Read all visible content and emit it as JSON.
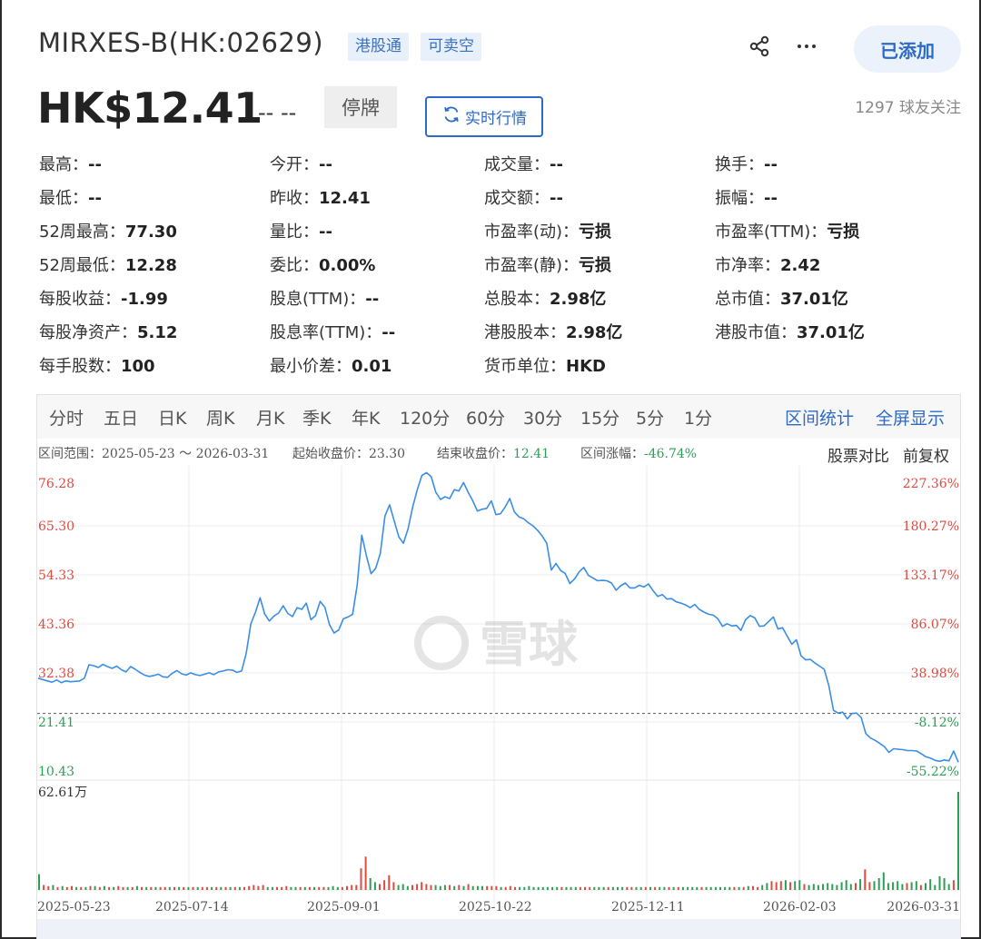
{
  "header": {
    "title": "MIRXES-B(HK:02629)",
    "tags": [
      "港股通",
      "可卖空"
    ],
    "share_icon": "share-icon",
    "more_icon": "more-dots-icon",
    "added_label": "已添加",
    "accent_color": "#2d6bc6"
  },
  "quote": {
    "price": "HK$12.41",
    "change": "-- --",
    "status": "停牌",
    "realtime_label": "实时行情",
    "realtime_icon": "refresh-icon",
    "followers": "1297 球友关注"
  },
  "stats": [
    [
      {
        "label": "最高：",
        "value": "--"
      },
      {
        "label": "今开：",
        "value": "--"
      },
      {
        "label": "成交量：",
        "value": "--"
      },
      {
        "label": "换手：",
        "value": "--"
      }
    ],
    [
      {
        "label": "最低：",
        "value": "--"
      },
      {
        "label": "昨收：",
        "value": "12.41"
      },
      {
        "label": "成交额：",
        "value": "--"
      },
      {
        "label": "振幅：",
        "value": "--"
      }
    ],
    [
      {
        "label": "52周最高：",
        "value": "77.30"
      },
      {
        "label": "量比：",
        "value": "--"
      },
      {
        "label": "市盈率(动)：",
        "value": "亏损"
      },
      {
        "label": "市盈率(TTM)：",
        "value": "亏损"
      }
    ],
    [
      {
        "label": "52周最低：",
        "value": "12.28"
      },
      {
        "label": "委比：",
        "value": "0.00%"
      },
      {
        "label": "市盈率(静)：",
        "value": "亏损"
      },
      {
        "label": "市净率：",
        "value": "2.42"
      }
    ],
    [
      {
        "label": "每股收益：",
        "value": "-1.99"
      },
      {
        "label": "股息(TTM)：",
        "value": "--"
      },
      {
        "label": "总股本：",
        "value": "2.98亿"
      },
      {
        "label": "总市值：",
        "value": "37.01亿"
      }
    ],
    [
      {
        "label": "每股净资产：",
        "value": "5.12"
      },
      {
        "label": "股息率(TTM)：",
        "value": "--"
      },
      {
        "label": "港股股本：",
        "value": "2.98亿"
      },
      {
        "label": "港股市值：",
        "value": "37.01亿"
      }
    ],
    [
      {
        "label": "每手股数：",
        "value": "100"
      },
      {
        "label": "最小价差：",
        "value": "0.01"
      },
      {
        "label": "货币单位：",
        "value": "HKD"
      }
    ]
  ],
  "tabs": [
    "分时",
    "五日",
    "日K",
    "周K",
    "月K",
    "季K",
    "年K",
    "120分",
    "60分",
    "30分",
    "15分",
    "5分",
    "1分"
  ],
  "tab_links": [
    "区间统计",
    "全屏显示"
  ],
  "range_info": {
    "range_label": "区间范围：",
    "range_value": "2025-05-23 ～ 2026-03-31",
    "start_label": "起始收盘价：",
    "start_value": "23.30",
    "end_label": "结束收盘价：",
    "end_value": "12.41",
    "change_label": "区间涨幅：",
    "change_value": "-46.74%",
    "compare": "股票对比",
    "adjust": "前复权"
  },
  "watermark": "雪球",
  "chart_data": {
    "type": "line",
    "y_ticks": [
      "76.28",
      "65.30",
      "54.33",
      "43.36",
      "32.38",
      "21.41",
      "10.43"
    ],
    "y_pct_ticks": [
      "227.36%",
      "180.27%",
      "133.17%",
      "86.07%",
      "38.98%",
      "-8.12%",
      "-55.22%"
    ],
    "ylim": [
      10.43,
      76.28
    ],
    "reference_close": 23.3,
    "x_ticks": [
      "2025-05-23",
      "2025-07-14",
      "2025-09-01",
      "2025-10-22",
      "2025-12-11",
      "2026-02-03",
      "2026-03-31"
    ],
    "volume_max_label": "62.61万",
    "series": [
      {
        "values": [
          31.2,
          30.9,
          30.6,
          30.3,
          30.8,
          30.2,
          30.6,
          30.4,
          30.5,
          30.6,
          31.2,
          34.2,
          34.0,
          33.6,
          34.3,
          33.8,
          33.4,
          33.9,
          33.1,
          32.6,
          33.8,
          33.2,
          32.5,
          31.9,
          31.6,
          31.8,
          32.1,
          31.5,
          31.4,
          32.3,
          32.9,
          32.2,
          31.9,
          32.4,
          32.0,
          31.8,
          32.1,
          32.4,
          32.0,
          32.6,
          32.8,
          33.1,
          33.0,
          32.5,
          32.8,
          36.8,
          43.4,
          46.0,
          49.2,
          45.6,
          44.0,
          45.1,
          45.8,
          47.4,
          45.7,
          45.0,
          47.0,
          46.6,
          48.0,
          44.3,
          45.2,
          48.4,
          47.1,
          43.2,
          41.3,
          42.0,
          44.5,
          44.9,
          45.5,
          52.0,
          63.2,
          58.6,
          54.6,
          55.8,
          59.1,
          67.5,
          70.0,
          66.4,
          62.8,
          61.4,
          64.6,
          69.5,
          73.4,
          76.6,
          77.2,
          76.3,
          72.8,
          71.2,
          71.8,
          71.4,
          73.4,
          73.1,
          75.0,
          72.8,
          70.9,
          68.6,
          69.0,
          69.2,
          70.9,
          67.8,
          68.0,
          69.5,
          71.4,
          68.4,
          67.3,
          66.9,
          66.0,
          65.3,
          64.3,
          63.0,
          61.4,
          55.4,
          56.9,
          55.3,
          54.6,
          52.4,
          53.4,
          55.0,
          56.0,
          54.2,
          53.6,
          53.0,
          53.1,
          53.0,
          52.5,
          50.9,
          51.9,
          52.5,
          51.4,
          51.4,
          52.0,
          51.6,
          52.3,
          50.8,
          49.5,
          49.9,
          48.9,
          49.0,
          48.3,
          48.0,
          47.6,
          47.0,
          47.7,
          46.6,
          46.0,
          45.5,
          45.3,
          44.5,
          42.8,
          43.4,
          42.9,
          43.0,
          41.9,
          44.3,
          45.2,
          44.7,
          42.8,
          42.9,
          43.9,
          44.9,
          42.2,
          42.5,
          40.6,
          38.8,
          39.8,
          36.2,
          35.3,
          35.4,
          34.6,
          33.9,
          33.2,
          29.5,
          24.0,
          23.4,
          23.6,
          22.1,
          23.3,
          23.4,
          22.4,
          18.8,
          17.8,
          17.3,
          16.6,
          15.9,
          14.6,
          15.4,
          15.3,
          15.2,
          15.0,
          15.0,
          14.9,
          14.3,
          13.6,
          13.3,
          12.8,
          12.6,
          12.9,
          12.7,
          14.9,
          12.4
        ]
      }
    ],
    "volumes": [
      0.16,
      0.05,
      0.04,
      0.05,
      0.03,
      0.04,
      0.03,
      0.04,
      0.03,
      0.03,
      0.03,
      0.04,
      0.04,
      0.03,
      0.04,
      0.03,
      0.03,
      0.04,
      0.03,
      0.03,
      0.03,
      0.04,
      0.03,
      0.03,
      0.03,
      0.03,
      0.03,
      0.03,
      0.03,
      0.03,
      0.03,
      0.03,
      0.03,
      0.03,
      0.03,
      0.03,
      0.03,
      0.03,
      0.03,
      0.03,
      0.03,
      0.03,
      0.03,
      0.03,
      0.03,
      0.04,
      0.05,
      0.04,
      0.05,
      0.03,
      0.03,
      0.03,
      0.03,
      0.04,
      0.03,
      0.03,
      0.03,
      0.03,
      0.03,
      0.03,
      0.03,
      0.03,
      0.03,
      0.04,
      0.03,
      0.03,
      0.04,
      0.05,
      0.05,
      0.22,
      0.34,
      0.12,
      0.08,
      0.06,
      0.1,
      0.15,
      0.08,
      0.05,
      0.06,
      0.04,
      0.05,
      0.06,
      0.08,
      0.06,
      0.05,
      0.05,
      0.04,
      0.05,
      0.05,
      0.04,
      0.05,
      0.04,
      0.06,
      0.04,
      0.04,
      0.04,
      0.04,
      0.04,
      0.04,
      0.03,
      0.03,
      0.04,
      0.03,
      0.03,
      0.03,
      0.04,
      0.03,
      0.03,
      0.03,
      0.03,
      0.03,
      0.03,
      0.03,
      0.03,
      0.03,
      0.03,
      0.03,
      0.03,
      0.03,
      0.03,
      0.03,
      0.03,
      0.03,
      0.03,
      0.03,
      0.03,
      0.03,
      0.03,
      0.03,
      0.03,
      0.03,
      0.03,
      0.03,
      0.03,
      0.03,
      0.03,
      0.03,
      0.03,
      0.03,
      0.03,
      0.03,
      0.03,
      0.03,
      0.03,
      0.03,
      0.03,
      0.03,
      0.03,
      0.03,
      0.03,
      0.03,
      0.03,
      0.04,
      0.04,
      0.03,
      0.05,
      0.07,
      0.09,
      0.08,
      0.09,
      0.1,
      0.08,
      0.09,
      0.1,
      0.06,
      0.05,
      0.06,
      0.05,
      0.06,
      0.07,
      0.06,
      0.05,
      0.08,
      0.1,
      0.06,
      0.07,
      0.11,
      0.21,
      0.08,
      0.09,
      0.12,
      0.18,
      0.07,
      0.08,
      0.09,
      0.06,
      0.07,
      0.08,
      0.09,
      0.05,
      0.07,
      0.11,
      0.05,
      0.14,
      0.12,
      0.06,
      0.1,
      1.0
    ],
    "volume_up": [
      false,
      true,
      true,
      false,
      true,
      false,
      true,
      true,
      false,
      true,
      false,
      true,
      false,
      true,
      false,
      true,
      false,
      true,
      true,
      false,
      true,
      false,
      true,
      false,
      true,
      false,
      true,
      true,
      false,
      true,
      false,
      true,
      false,
      true,
      false,
      true,
      true,
      false,
      true,
      false,
      true,
      false,
      true,
      false,
      true,
      true,
      true,
      true,
      true,
      false,
      false,
      true,
      true,
      true,
      false,
      false,
      true,
      false,
      true,
      false,
      true,
      true,
      false,
      false,
      false,
      true,
      true,
      true,
      true,
      true,
      true,
      false,
      false,
      true,
      true,
      true,
      true,
      false,
      false,
      false,
      true,
      true,
      true,
      true,
      true,
      false,
      false,
      false,
      true,
      false,
      true,
      false,
      true,
      false,
      false,
      false,
      true,
      true,
      true,
      false,
      true,
      true,
      true,
      false,
      false,
      false,
      false,
      false,
      false,
      false,
      false,
      false,
      true,
      false,
      false,
      false,
      true,
      true,
      true,
      false,
      false,
      false,
      true,
      false,
      false,
      false,
      true,
      true,
      false,
      false,
      true,
      false,
      true,
      false,
      false,
      true,
      false,
      true,
      false,
      false,
      false,
      false,
      true,
      false,
      false,
      false,
      false,
      false,
      false,
      true,
      false,
      true,
      false,
      true,
      true,
      false,
      false,
      true,
      true,
      true,
      false,
      true,
      false,
      false,
      true,
      false,
      false,
      false,
      false,
      false,
      false,
      false,
      false,
      false,
      false,
      true,
      false,
      true,
      true,
      false,
      false,
      false,
      false,
      false,
      false,
      false,
      true,
      false,
      false,
      true,
      false,
      false,
      false,
      false,
      false,
      false,
      true,
      false,
      true,
      true
    ],
    "colors": {
      "line": "#3a8ee6",
      "up": "#e04a3f",
      "down": "#2e9e57",
      "grid": "#eeeeee"
    }
  }
}
